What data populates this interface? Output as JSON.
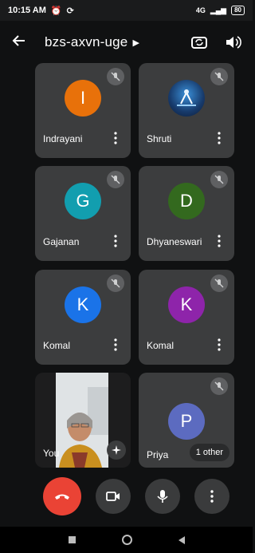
{
  "status_bar": {
    "time": "10:15 AM",
    "notification_icons": [
      "alarm-icon",
      "sync-icon"
    ],
    "network": "4G",
    "battery": "80"
  },
  "header": {
    "meeting_code": "bzs-axvn-uge",
    "back_icon": "arrow-left-icon",
    "chevron_icon": "chevron-right-icon",
    "camera_switch_icon": "switch-camera-icon",
    "audio_icon": "speaker-icon"
  },
  "participants": [
    {
      "name": "Indrayani",
      "initial": "I",
      "avatar_color": "#e8710a",
      "muted": true
    },
    {
      "name": "Shruti",
      "initial": "",
      "avatar_color": "#1f3a5f",
      "muted": true,
      "has_photo": true
    },
    {
      "name": "Gajanan",
      "initial": "G",
      "avatar_color": "#129eaf",
      "muted": true
    },
    {
      "name": "Dhyaneswari",
      "initial": "D",
      "avatar_color": "#33691e",
      "muted": true
    },
    {
      "name": "Komal",
      "initial": "K",
      "avatar_color": "#1a73e8",
      "muted": true
    },
    {
      "name": "Komal",
      "initial": "K",
      "avatar_color": "#8e24aa",
      "muted": true
    },
    {
      "name": "You",
      "self_view": true
    },
    {
      "name": "Priya",
      "initial": "P",
      "avatar_color": "#5c6bc0",
      "muted": true,
      "others_badge": "1 other"
    }
  ],
  "controls": {
    "end_call_color": "#ea4335",
    "buttons": [
      "end-call-icon",
      "camera-icon",
      "microphone-icon",
      "more-options-icon"
    ]
  }
}
